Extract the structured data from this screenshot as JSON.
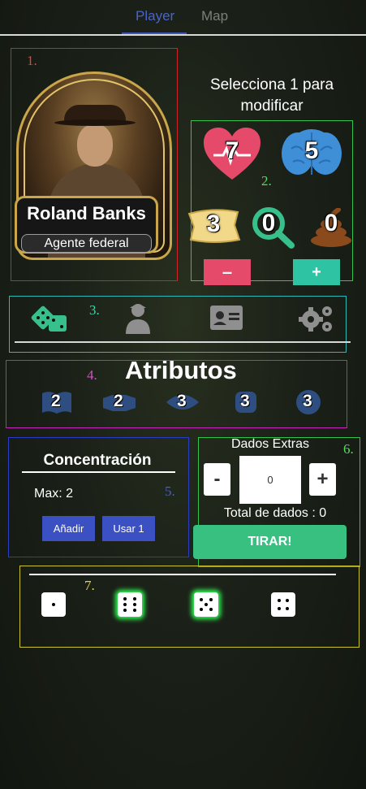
{
  "tabs": {
    "player": "Player",
    "map": "Map"
  },
  "sections": {
    "portrait": "1.",
    "stats": "2.",
    "nav": "3.",
    "attributes": "4.",
    "concentration": "5.",
    "extra_dice": "6.",
    "roll": "7."
  },
  "character": {
    "name": "Roland Banks",
    "role": "Agente federal"
  },
  "stats": {
    "prompt": "Selecciona 1 para modificar",
    "health": "7",
    "sanity": "5",
    "money": "3",
    "clues": "0",
    "doom": "0",
    "minus_label": "–",
    "plus_label": "+"
  },
  "nav_icons": [
    "dice-icon",
    "investigator-icon",
    "id-card-icon",
    "settings-icon"
  ],
  "attributes": {
    "title": "Atributos",
    "values": [
      "2",
      "2",
      "3",
      "3",
      "3"
    ],
    "icons": [
      "book-icon",
      "handshake-icon",
      "eye-icon",
      "fist-icon",
      "gear-hand-icon"
    ]
  },
  "concentration": {
    "title": "Concentración",
    "max": "Max: 2",
    "add_label": "Añadir",
    "use_label": "Usar 1"
  },
  "extra_dice": {
    "title": "Dados Extras",
    "minus": "-",
    "plus": "+",
    "value": "0",
    "total": "Total de dados : 0",
    "roll_label": "TIRAR!"
  },
  "roll_results": {
    "dice": [
      1,
      6,
      5,
      4
    ],
    "highlighted": [
      false,
      true,
      true,
      false
    ]
  },
  "colors": {
    "tab_active": "#4a63c9",
    "health": "#e64a6b",
    "sanity": "#3e8fd8",
    "money": "#f2d98a",
    "clues": "#38c08c",
    "doom": "#8a4a1c",
    "minus_button": "#e64a6b",
    "plus_button": "#2ec4a3",
    "blue_button": "#3b50c2",
    "roll_button": "#37c080",
    "glow": "#2fff52"
  }
}
